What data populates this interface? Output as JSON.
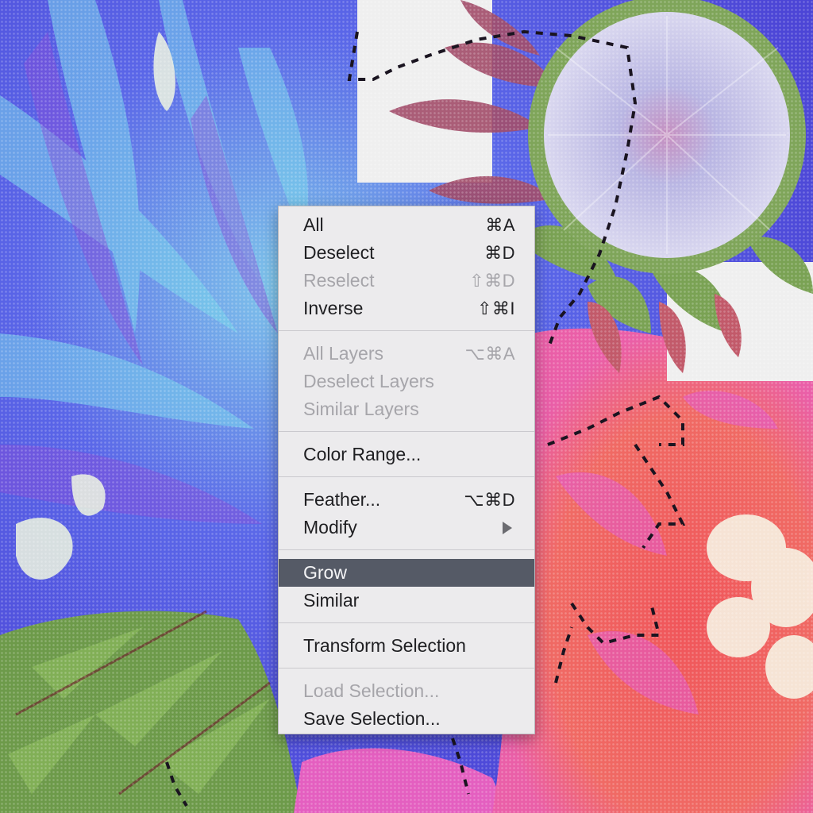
{
  "menu": {
    "items": [
      {
        "label": "All",
        "shortcut": "⌘A",
        "enabled": true
      },
      {
        "label": "Deselect",
        "shortcut": "⌘D",
        "enabled": true
      },
      {
        "label": "Reselect",
        "shortcut": "⇧⌘D",
        "enabled": false
      },
      {
        "label": "Inverse",
        "shortcut": "⇧⌘I",
        "enabled": true
      },
      {
        "label": "All Layers",
        "shortcut": "⌥⌘A",
        "enabled": false
      },
      {
        "label": "Deselect Layers",
        "shortcut": "",
        "enabled": false
      },
      {
        "label": "Similar Layers",
        "shortcut": "",
        "enabled": false
      },
      {
        "label": "Color Range...",
        "shortcut": "",
        "enabled": true
      },
      {
        "label": "Feather...",
        "shortcut": "⌥⌘D",
        "enabled": true
      },
      {
        "label": "Modify",
        "shortcut": "",
        "enabled": true,
        "submenu": true
      },
      {
        "label": "Grow",
        "shortcut": "",
        "enabled": true,
        "highlighted": true
      },
      {
        "label": "Similar",
        "shortcut": "",
        "enabled": true
      },
      {
        "label": "Transform Selection",
        "shortcut": "",
        "enabled": true
      },
      {
        "label": "Load Selection...",
        "shortcut": "",
        "enabled": false
      },
      {
        "label": "Save Selection...",
        "shortcut": "",
        "enabled": true
      }
    ]
  },
  "colors": {
    "highlight": "#555a66",
    "menu_bg": "#ecebed",
    "disabled_text": "#a6a5aa"
  }
}
